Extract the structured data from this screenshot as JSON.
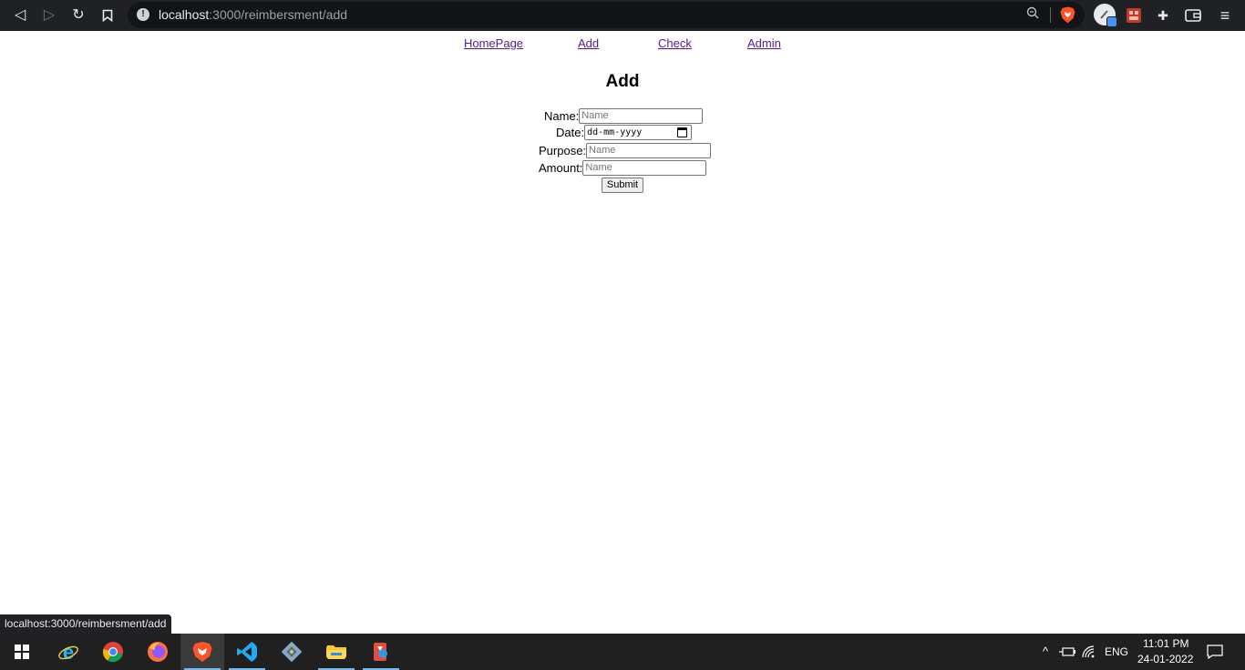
{
  "browser": {
    "address_host": "localhost",
    "address_path": ":3000/reimbersment/add",
    "back_glyph": "◁",
    "forward_glyph": "▷",
    "reload_glyph": "↻",
    "bookmark_glyph": "🔖",
    "info_glyph": "!",
    "zoom_glyph": "⚲",
    "extensions_glyph": "✚",
    "wallet_glyph": "▭",
    "menu_glyph": "≡",
    "icons": [
      "back-icon",
      "forward-icon",
      "reload-icon",
      "bookmark-icon",
      "site-info-icon",
      "zoom-icon",
      "brave-shields-icon",
      "profile-avatar",
      "extension-icon",
      "extensions-puzzle-icon",
      "wallet-icon",
      "menu-icon"
    ]
  },
  "site_nav": {
    "links": [
      {
        "label": "HomePage"
      },
      {
        "label": "Add"
      },
      {
        "label": "Check"
      },
      {
        "label": "Admin"
      }
    ]
  },
  "page": {
    "title": "Add"
  },
  "form": {
    "name_label": "Name:",
    "name_placeholder": "Name",
    "date_label": "Date:",
    "date_placeholder": "dd-mm-yyyy",
    "purpose_label": "Purpose:",
    "purpose_placeholder": "Name",
    "amount_label": "Amount:",
    "amount_placeholder": "Name",
    "submit_label": "Submit"
  },
  "status_bar": {
    "url": "localhost:3000/reimbersment/add"
  },
  "taskbar": {
    "apps": [
      "windows-start-icon",
      "internet-explorer-icon",
      "chrome-icon",
      "firefox-icon",
      "brave-icon",
      "vscode-icon",
      "git-icon",
      "file-explorer-icon",
      "app-icon"
    ],
    "tray_chevron_glyph": "^",
    "language": "ENG",
    "time": "11:01 PM",
    "date": "24-01-2022",
    "notification_glyph": "▢"
  },
  "colors": {
    "link_visited": "#551a8b",
    "browser_bg": "#202124",
    "taskbar_bg": "#202020",
    "taskbar_accent": "#76b9ed"
  }
}
